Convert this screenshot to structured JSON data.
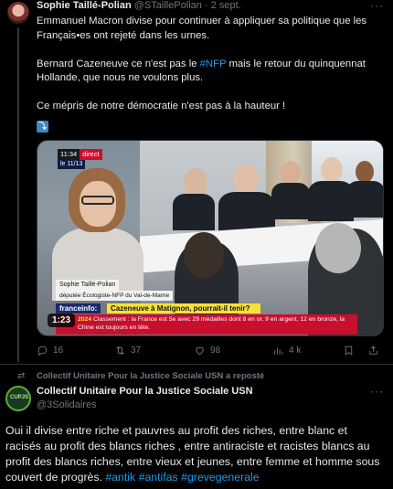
{
  "tweet1": {
    "author_name": "Sophie Taillé-Polian",
    "author_handle": "@STaillePolian",
    "date": "2 sept.",
    "more_icon": "more-dots-icon",
    "paragraph1": "Emmanuel Macron divise pour continuer à appliquer sa politique que les Français•es ont rejeté dans les urnes.",
    "paragraph2_before": "Bernard Cazeneuve ce n'est pas le ",
    "paragraph2_link": "#NFP",
    "paragraph2_after": " mais le retour du quinquennat Hollande, que nous ne voulons plus.",
    "paragraph3": "Ce mépris de notre démocratie n'est pas à la hauteur !",
    "emoji": "⤵",
    "video": {
      "live_time": "11:34",
      "live_label": "direct",
      "show_label": "le 11/13",
      "guest_name": "Sophie Taillé-Polian",
      "guest_role": "députée Écologiste-NFP du Val-de-Marne",
      "channel": "franceinfo:",
      "headline": "Cazeneuve à Matignon, pourrait-il tenir?",
      "ticker_year": "2024",
      "ticker_text": "Classement : la France est 5e avec 29 médailles dont 8 en or, 9 en argent, 12 en bronze, la Chine est toujours en tête.",
      "duration": "1:23"
    },
    "stats": {
      "replies": "16",
      "reposts": "37",
      "likes": "98",
      "views": "4 k"
    }
  },
  "repost_context": "Collectif Unitaire Pour la Justice Sociale USN a reposté",
  "tweet2": {
    "author_name": "Collectif Unitaire Pour la Justice Sociale USN",
    "author_handle": "@3Solidaires",
    "avatar_text": "CUPJS",
    "text": "Oui il divise entre riche et pauvres au profit des riches, entre blanc et racisés au profit des blancs riches , entre antiraciste et racistes blancs au profit des blancs riches, entre vieux et jeunes, entre femme et homme sous couvert de progrès. ",
    "hashtags": [
      "#antik",
      "#antifas",
      "#grevegenerale"
    ]
  },
  "colors": {
    "background": "#000000",
    "text": "#e7e9ea",
    "secondary": "#71767b",
    "link": "#1d9bf0",
    "border": "#2f3336"
  }
}
